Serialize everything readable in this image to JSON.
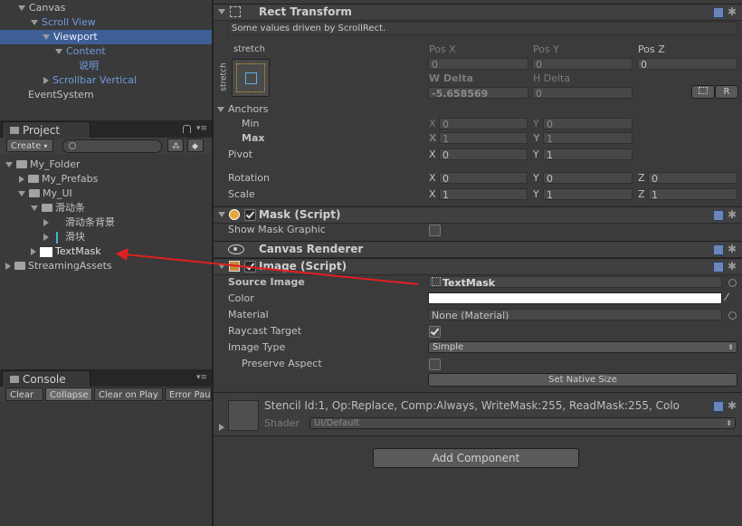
{
  "hierarchy": {
    "items": [
      {
        "label": "Canvas"
      },
      {
        "label": "Scroll View"
      },
      {
        "label": "Viewport"
      },
      {
        "label": "Content"
      },
      {
        "label": "说明"
      },
      {
        "label": "Scrollbar Vertical"
      },
      {
        "label": "EventSystem"
      }
    ]
  },
  "project": {
    "tab_label": "Project",
    "create_label": "Create",
    "tree": [
      {
        "label": "My_Folder"
      },
      {
        "label": "My_Prefabs"
      },
      {
        "label": "My_UI"
      },
      {
        "label": "滑动条"
      },
      {
        "label": "滑动条背景"
      },
      {
        "label": "滑块"
      },
      {
        "label": "TextMask"
      },
      {
        "label": "StreamingAssets"
      }
    ]
  },
  "console": {
    "tab_label": "Console",
    "buttons": [
      "Clear",
      "Collapse",
      "Clear on Play",
      "Error Pau"
    ]
  },
  "inspector": {
    "rect_transform": {
      "title": "Rect Transform",
      "notice": "Some values driven by ScrollRect.",
      "anchor_preset_top": "stretch",
      "anchor_preset_side": "stretch",
      "pos_x_label": "Pos X",
      "pos_y_label": "Pos Y",
      "pos_z_label": "Pos Z",
      "pos_x": "0",
      "pos_y": "0",
      "pos_z": "0",
      "w_delta_label": "W Delta",
      "h_delta_label": "H Delta",
      "w_delta": "-5.658569",
      "h_delta": "0",
      "r_button": "R",
      "anchors_label": "Anchors",
      "min_label": "Min",
      "max_label": "Max",
      "x_label": "X",
      "y_label": "Y",
      "z_label": "Z",
      "min_x": "0",
      "min_y": "0",
      "max_x": "1",
      "max_y": "1",
      "pivot_label": "Pivot",
      "pivot_x": "0",
      "pivot_y": "1",
      "rotation_label": "Rotation",
      "rot_x": "0",
      "rot_y": "0",
      "rot_z": "0",
      "scale_label": "Scale",
      "scale_x": "1",
      "scale_y": "1",
      "scale_z": "1"
    },
    "mask": {
      "title": "Mask (Script)",
      "show_graphic_label": "Show Mask Graphic"
    },
    "canvas_renderer": {
      "title": "Canvas Renderer"
    },
    "image": {
      "title": "Image (Script)",
      "source_image_label": "Source Image",
      "source_image_value": "TextMask",
      "color_label": "Color",
      "color_value": "#ffffff",
      "material_label": "Material",
      "material_value": "None (Material)",
      "raycast_label": "Raycast Target",
      "image_type_label": "Image Type",
      "image_type_value": "Simple",
      "preserve_label": "Preserve Aspect",
      "native_size_button": "Set Native Size"
    },
    "material_preview": {
      "stencil_text": "Stencil Id:1, Op:Replace, Comp:Always, WriteMask:255, ReadMask:255, Colo",
      "shader_label": "Shader",
      "shader_value": "UI/Default"
    },
    "add_component_button": "Add Component"
  }
}
